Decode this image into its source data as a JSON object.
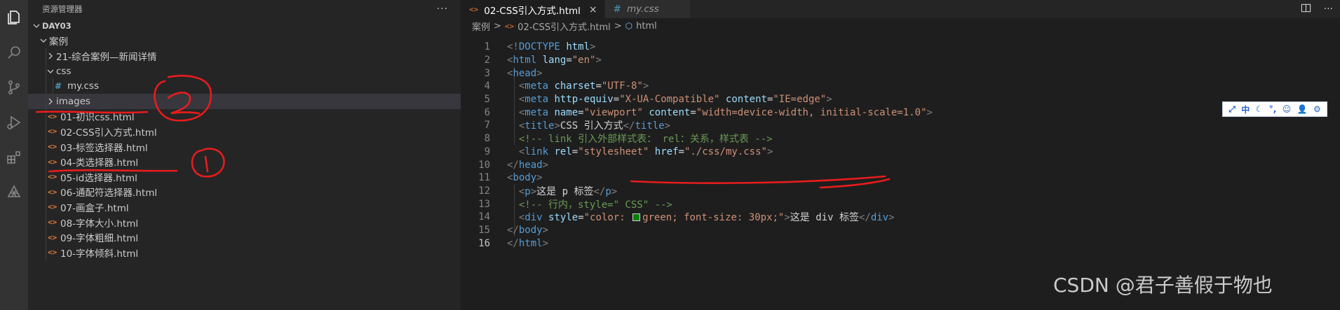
{
  "explorer": {
    "title": "资源管理器",
    "more_label": "···",
    "root_label": "DAY03",
    "tree": [
      {
        "label": "案例",
        "kind": "folder-open",
        "depth": 1
      },
      {
        "label": "21-综合案例—新闻详情",
        "kind": "folder",
        "depth": 2
      },
      {
        "label": "css",
        "kind": "folder-open",
        "depth": 2
      },
      {
        "label": "my.css",
        "kind": "css",
        "depth": 3
      },
      {
        "label": "images",
        "kind": "folder",
        "depth": 2,
        "selected": true
      },
      {
        "label": "01-初识css.html",
        "kind": "html",
        "depth": 2
      },
      {
        "label": "02-CSS引入方式.html",
        "kind": "html",
        "depth": 2
      },
      {
        "label": "03-标签选择器.html",
        "kind": "html",
        "depth": 2
      },
      {
        "label": "04-类选择器.html",
        "kind": "html",
        "depth": 2
      },
      {
        "label": "05-id选择器.html",
        "kind": "html",
        "depth": 2
      },
      {
        "label": "06-通配符选择器.html",
        "kind": "html",
        "depth": 2
      },
      {
        "label": "07-画盒子.html",
        "kind": "html",
        "depth": 2
      },
      {
        "label": "08-字体大小.html",
        "kind": "html",
        "depth": 2
      },
      {
        "label": "09-字体粗细.html",
        "kind": "html",
        "depth": 2
      },
      {
        "label": "10-字体倾斜.html",
        "kind": "html",
        "depth": 2
      }
    ]
  },
  "tabs": [
    {
      "label": "02-CSS引入方式.html",
      "icon": "html",
      "active": true,
      "close": "×"
    },
    {
      "label": "my.css",
      "icon": "css",
      "active": false
    }
  ],
  "breadcrumb": {
    "items": [
      "案例",
      "02-CSS引入方式.html",
      "html"
    ],
    "separator": ">"
  },
  "editor": {
    "current_line": 16,
    "lines": [
      [
        [
          "br",
          "<!"
        ],
        [
          "tag",
          "DOCTYPE"
        ],
        [
          "text",
          " "
        ],
        [
          "attr",
          "html"
        ],
        [
          "br",
          ">"
        ]
      ],
      [
        [
          "br",
          "<"
        ],
        [
          "tag",
          "html"
        ],
        [
          "text",
          " "
        ],
        [
          "attr",
          "lang"
        ],
        [
          "text",
          "="
        ],
        [
          "str",
          "\"en\""
        ],
        [
          "br",
          ">"
        ]
      ],
      [
        [
          "br",
          "<"
        ],
        [
          "tag",
          "head"
        ],
        [
          "br",
          ">"
        ]
      ],
      [
        [
          "text",
          "  "
        ],
        [
          "br",
          "<"
        ],
        [
          "tag",
          "meta"
        ],
        [
          "text",
          " "
        ],
        [
          "attr",
          "charset"
        ],
        [
          "text",
          "="
        ],
        [
          "str",
          "\"UTF-8\""
        ],
        [
          "br",
          ">"
        ]
      ],
      [
        [
          "text",
          "  "
        ],
        [
          "br",
          "<"
        ],
        [
          "tag",
          "meta"
        ],
        [
          "text",
          " "
        ],
        [
          "attr",
          "http-equiv"
        ],
        [
          "text",
          "="
        ],
        [
          "str",
          "\"X-UA-Compatible\""
        ],
        [
          "text",
          " "
        ],
        [
          "attr",
          "content"
        ],
        [
          "text",
          "="
        ],
        [
          "str",
          "\"IE=edge\""
        ],
        [
          "br",
          ">"
        ]
      ],
      [
        [
          "text",
          "  "
        ],
        [
          "br",
          "<"
        ],
        [
          "tag",
          "meta"
        ],
        [
          "text",
          " "
        ],
        [
          "attr",
          "name"
        ],
        [
          "text",
          "="
        ],
        [
          "str",
          "\"viewport\""
        ],
        [
          "text",
          " "
        ],
        [
          "attr",
          "content"
        ],
        [
          "text",
          "="
        ],
        [
          "str",
          "\"width=device-width, initial-scale=1.0\""
        ],
        [
          "br",
          ">"
        ]
      ],
      [
        [
          "text",
          "  "
        ],
        [
          "br",
          "<"
        ],
        [
          "tag",
          "title"
        ],
        [
          "br",
          ">"
        ],
        [
          "text",
          "CSS 引入方式"
        ],
        [
          "br",
          "</"
        ],
        [
          "tag",
          "title"
        ],
        [
          "br",
          ">"
        ]
      ],
      [
        [
          "text",
          "  "
        ],
        [
          "com",
          "<!-- link 引入外部样式表： rel：关系，样式表 -->"
        ]
      ],
      [
        [
          "text",
          "  "
        ],
        [
          "br",
          "<"
        ],
        [
          "tag",
          "link"
        ],
        [
          "text",
          " "
        ],
        [
          "attr",
          "rel"
        ],
        [
          "text",
          "="
        ],
        [
          "str",
          "\"stylesheet\""
        ],
        [
          "text",
          " "
        ],
        [
          "attr",
          "href"
        ],
        [
          "text",
          "="
        ],
        [
          "str",
          "\"./css/my.css\""
        ],
        [
          "br",
          ">"
        ]
      ],
      [
        [
          "br",
          "</"
        ],
        [
          "tag",
          "head"
        ],
        [
          "br",
          ">"
        ]
      ],
      [
        [
          "br",
          "<"
        ],
        [
          "tag",
          "body"
        ],
        [
          "br",
          ">"
        ]
      ],
      [
        [
          "text",
          "  "
        ],
        [
          "br",
          "<"
        ],
        [
          "tag",
          "p"
        ],
        [
          "br",
          ">"
        ],
        [
          "text",
          "这是 p 标签"
        ],
        [
          "br",
          "</"
        ],
        [
          "tag",
          "p"
        ],
        [
          "br",
          ">"
        ]
      ],
      [
        [
          "text",
          "  "
        ],
        [
          "com",
          "<!-- 行内，style=\" CSS\" -->"
        ]
      ],
      [
        [
          "text",
          "  "
        ],
        [
          "br",
          "<"
        ],
        [
          "tag",
          "div"
        ],
        [
          "text",
          " "
        ],
        [
          "attr",
          "style"
        ],
        [
          "text",
          "="
        ],
        [
          "str",
          "\"color: "
        ],
        [
          "swatch",
          "#008000"
        ],
        [
          "str",
          "green; font-size: 30px;\""
        ],
        [
          "br",
          ">"
        ],
        [
          "text",
          "这是 div 标签"
        ],
        [
          "br",
          "</"
        ],
        [
          "tag",
          "div"
        ],
        [
          "br",
          ">"
        ]
      ],
      [
        [
          "br",
          "</"
        ],
        [
          "tag",
          "body"
        ],
        [
          "br",
          ">"
        ]
      ],
      [
        [
          "br",
          "</"
        ],
        [
          "tag",
          "html"
        ],
        [
          "br",
          ">"
        ]
      ]
    ]
  },
  "ime_toolbar": [
    "⤢",
    "中",
    "☾",
    "°,",
    "☺",
    "👤",
    "⚙"
  ],
  "watermark": "CSDN @君子善假于物也",
  "annotations": [
    "2",
    "1"
  ],
  "colors": {
    "annotation_red": "#e81c1c",
    "tag": "#569cd6",
    "attr": "#9cdcfe",
    "string": "#ce9178",
    "comment": "#6a9955"
  }
}
